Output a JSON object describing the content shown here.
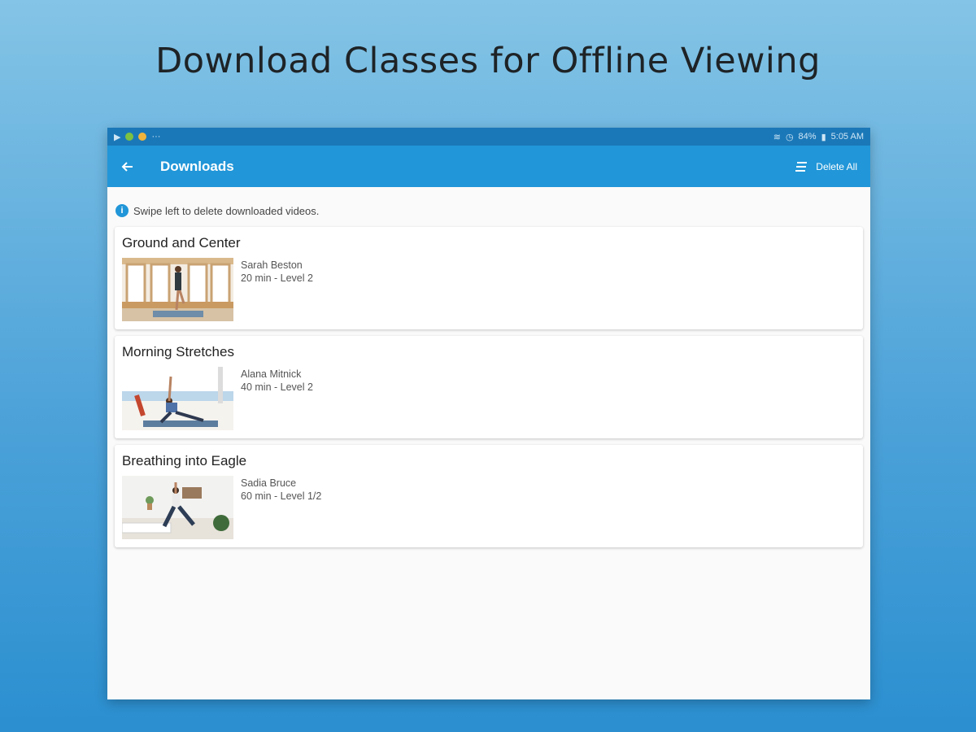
{
  "headline": "Download Classes for Offline Viewing",
  "status_bar": {
    "battery": "84%",
    "time": "5:05 AM",
    "notifications": "···"
  },
  "app_bar": {
    "title": "Downloads",
    "delete_all_label": "Delete All"
  },
  "hint": {
    "text": "Swipe left to delete downloaded videos."
  },
  "downloads": [
    {
      "title": "Ground and Center",
      "instructor": "Sarah Beston",
      "meta": "20 min - Level 2"
    },
    {
      "title": "Morning Stretches",
      "instructor": "Alana Mitnick",
      "meta": "40 min - Level 2"
    },
    {
      "title": "Breathing into Eagle",
      "instructor": "Sadia Bruce",
      "meta": "60 min - Level 1/2"
    }
  ],
  "colors": {
    "app_bar": "#2196d8",
    "status_bar": "#1b78b8",
    "accent": "#2196d8"
  }
}
